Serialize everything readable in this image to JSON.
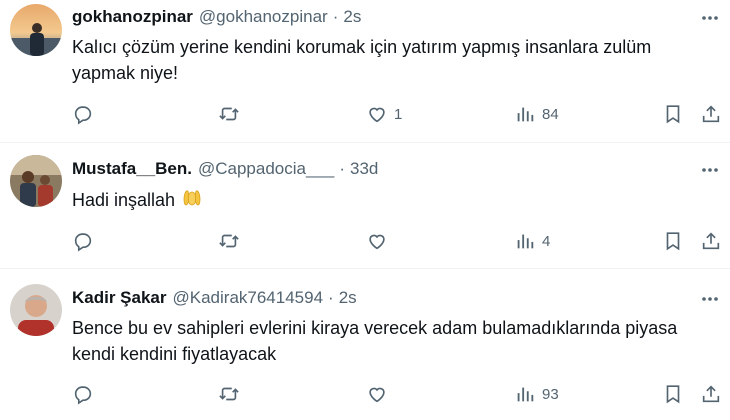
{
  "tweets": [
    {
      "name": "gokhanozpinar",
      "handle": "@gokhanozpinar",
      "separator": "·",
      "time": "2s",
      "text": "Kalıcı çözüm yerine kendini korumak için yatırım yapmış insanlara zulüm yapmak niye!",
      "replies": "",
      "retweets": "",
      "likes": "1",
      "views": "84"
    },
    {
      "name": "Mustafa__Ben.",
      "handle": "@Cappadocia___",
      "separator": "·",
      "time": "33d",
      "text": "Hadi inşallah",
      "emoji": "raised-hands-emoji",
      "replies": "",
      "retweets": "",
      "likes": "",
      "views": "4"
    },
    {
      "name": "Kadir Şakar",
      "handle": "@Kadirak76414594",
      "separator": "·",
      "time": "2s",
      "text": "Bence  bu ev sahipleri evlerini kiraya verecek adam bulamadıklarında piyasa kendi kendini fiyatlayacak",
      "replies": "",
      "retweets": "",
      "likes": "",
      "views": "93"
    }
  ],
  "icons": {
    "reply": "reply-icon",
    "retweet": "retweet-icon",
    "like": "like-icon",
    "views": "views-icon",
    "bookmark": "bookmark-icon",
    "share": "share-icon",
    "more": "more-icon"
  },
  "colors": {
    "text": "#0f1419",
    "secondary": "#536471",
    "divider": "#eff3f4"
  }
}
